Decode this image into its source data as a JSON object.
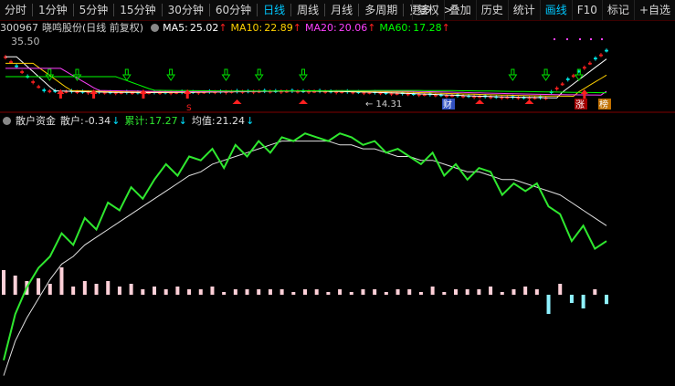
{
  "toolbar": {
    "items": [
      "分时",
      "1分钟",
      "5分钟",
      "15分钟",
      "30分钟",
      "60分钟",
      "日线",
      "周线",
      "月线",
      "多周期",
      "更多"
    ],
    "active": "日线",
    "more_arrow": ">",
    "right_items": [
      "复权",
      "叠加",
      "历史",
      "统计",
      "画线",
      "F10",
      "标记",
      "+自选"
    ],
    "right_highlight": "画线"
  },
  "stock": {
    "code": "300967",
    "name": "晓鸣股份",
    "mode": "(日线 前复权)",
    "ma5_label": "MA5:",
    "ma5": "25.02",
    "ma10_label": "MA10:",
    "ma10": "22.89",
    "ma20_label": "MA20:",
    "ma20": "20.06",
    "ma60_label": "MA60:",
    "ma60": "17.28",
    "up_arrow": "↑",
    "high_price": "35.50",
    "low_price": "14.31",
    "low_price_arrow": "←",
    "markers": {
      "cai": "财",
      "zhang": "涨",
      "bang": "榜",
      "s": "S"
    }
  },
  "indicator": {
    "name": "散户资金",
    "sanhu_label": "散户:",
    "sanhu": "-0.34",
    "sanhu_arrow": "↓",
    "leiji_label": "累计:",
    "leiji": "17.27",
    "leiji_arrow": "↓",
    "junzhi_label": "均值:",
    "junzhi": "21.24",
    "junzhi_arrow": "↓"
  },
  "colors": {
    "ma5": "#ffffff",
    "ma10": "#ffd000",
    "ma20": "#ff40ff",
    "ma60": "#00ff00",
    "up": "#ff2020",
    "down": "#00e000",
    "green_line": "#2fe82f",
    "avg_line": "#e0e0e0",
    "bar_pos": "#ffd0d8",
    "bar_neg": "#8ff2ff",
    "active_tab": "#00c8ff"
  },
  "chart_data": {
    "type": "line",
    "series": [
      {
        "name": "累计",
        "values": [
          14.2,
          15.4,
          16.1,
          16.6,
          16.9,
          17.5,
          17.2,
          17.9,
          17.6,
          18.3,
          18.1,
          18.7,
          18.4,
          18.9,
          19.3,
          19.0,
          19.5,
          19.4,
          19.7,
          19.2,
          19.8,
          19.5,
          19.9,
          19.6,
          20.0,
          19.9,
          20.1,
          20.0,
          19.9,
          20.1,
          20.0,
          19.8,
          19.9,
          19.6,
          19.7,
          19.5,
          19.3,
          19.6,
          19.0,
          19.3,
          18.9,
          19.2,
          19.1,
          18.5,
          18.8,
          18.6,
          18.8,
          18.2,
          18.0,
          17.3,
          17.7,
          17.1,
          17.3
        ]
      },
      {
        "name": "均值",
        "values": [
          13.8,
          14.7,
          15.3,
          15.8,
          16.3,
          16.7,
          16.9,
          17.2,
          17.4,
          17.6,
          17.8,
          18.0,
          18.2,
          18.4,
          18.6,
          18.8,
          19.0,
          19.1,
          19.3,
          19.4,
          19.5,
          19.6,
          19.7,
          19.8,
          19.9,
          19.9,
          19.9,
          19.9,
          19.9,
          19.8,
          19.8,
          19.7,
          19.7,
          19.6,
          19.5,
          19.5,
          19.4,
          19.4,
          19.3,
          19.2,
          19.1,
          19.1,
          19.0,
          18.9,
          18.9,
          18.8,
          18.7,
          18.6,
          18.5,
          18.3,
          18.1,
          17.9,
          17.7
        ]
      },
      {
        "name": "散户",
        "values": [
          0.9,
          0.7,
          0.5,
          0.6,
          0.4,
          1.0,
          0.3,
          0.5,
          0.4,
          0.5,
          0.3,
          0.4,
          0.2,
          0.3,
          0.2,
          0.3,
          0.2,
          0.2,
          0.3,
          0.1,
          0.2,
          0.2,
          0.2,
          0.2,
          0.2,
          0.1,
          0.2,
          0.2,
          0.1,
          0.2,
          0.1,
          0.2,
          0.2,
          0.1,
          0.2,
          0.2,
          0.1,
          0.3,
          0.1,
          0.2,
          0.2,
          0.2,
          0.3,
          0.1,
          0.2,
          0.3,
          0.2,
          -0.7,
          0.4,
          -0.3,
          -0.5,
          0.2,
          -0.34
        ]
      }
    ]
  }
}
